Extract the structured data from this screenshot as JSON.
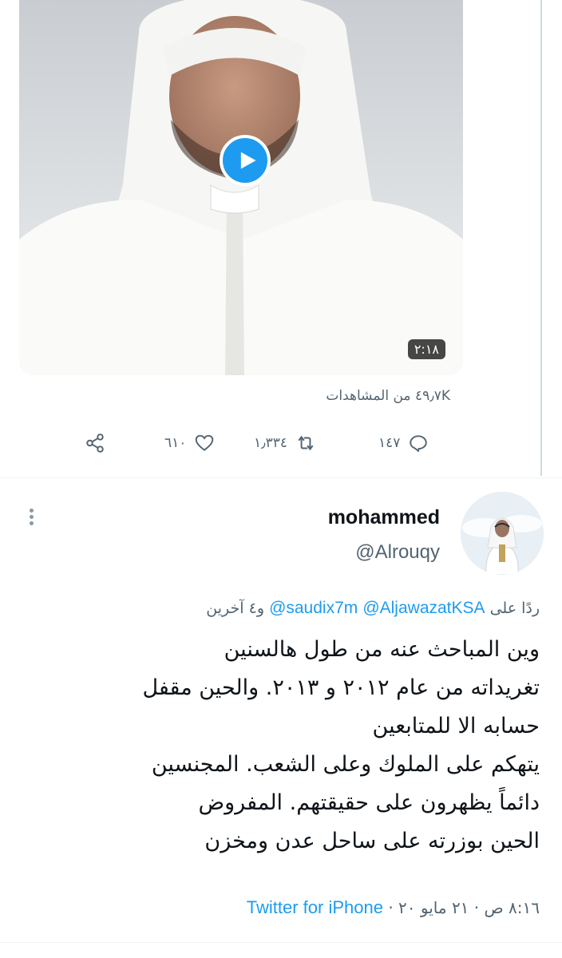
{
  "quoted_tweet": {
    "video": {
      "duration": "٢:١٨",
      "play_icon": "play-icon"
    },
    "views_text": "٤٩٫٧K من المشاهدات",
    "actions": {
      "reply_count": "١٤٧",
      "retweet_count": "١٫٣٣٤",
      "like_count": "٦١٠",
      "icons": [
        "reply-icon",
        "retweet-icon",
        "heart-icon",
        "share-icon"
      ]
    }
  },
  "reply_tweet": {
    "display_name": "mohammed",
    "handle": "@Alrouqy",
    "reply_prefix": "ردًا على",
    "mentions": [
      "@AljawazatKSA",
      "@saudix7m"
    ],
    "reply_suffix": "و٤ آخرين",
    "body_lines": [
      "وين المباحث عنه من طول هالسنين",
      "تغريداته من عام ٢٠١٢ و ٢٠١٣. والحين مقفل",
      "حسابه الا للمتابعين",
      "يتهكم على الملوك وعلى الشعب. المجنسين",
      "دائماً يظهرون على حقيقتهم. المفروض",
      "الحين بوزرته على ساحل عدن ومخزن"
    ],
    "timestamp": "٨:١٦ ص · ٢١ مايو ٢٠",
    "separator": "·",
    "source": "Twitter for iPhone"
  },
  "colors": {
    "accent": "#1d9bf0",
    "text_primary": "#0f1419",
    "text_secondary": "#536471",
    "thread_line": "#cfd9de"
  }
}
